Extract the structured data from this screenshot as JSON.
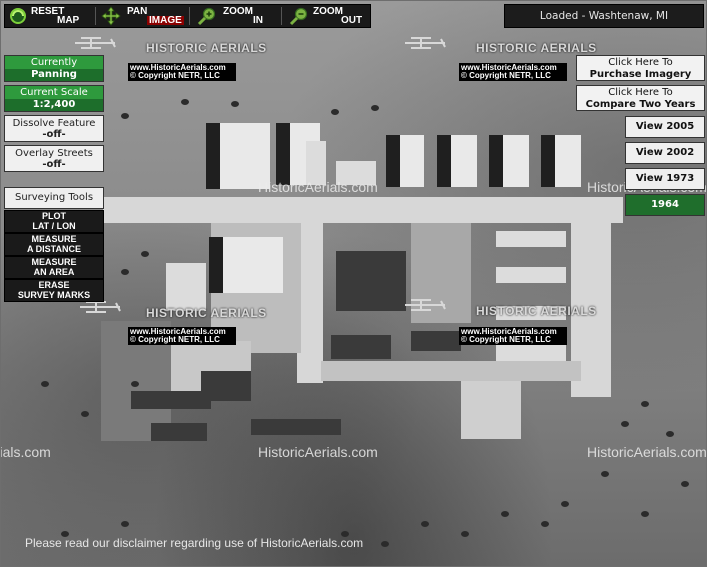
{
  "toolbar": {
    "reset": {
      "line1": "RESET",
      "line2": "MAP",
      "icon": "reset-globe-icon"
    },
    "pan": {
      "line1": "PAN",
      "line2": "IMAGE",
      "icon": "pan-arrows-icon"
    },
    "zoom_in": {
      "line1": "ZOOM",
      "line2": "IN",
      "icon": "magnifier-plus-icon"
    },
    "zoom_out": {
      "line1": "ZOOM",
      "line2": "OUT",
      "icon": "magnifier-minus-icon"
    }
  },
  "status": "Loaded - Washtenaw, MI",
  "left_panel": {
    "currently": {
      "label": "Currently",
      "value": "Panning"
    },
    "scale": {
      "label": "Current Scale",
      "value": "1:2,400"
    },
    "dissolve": {
      "label": "Dissolve Feature",
      "value": "-off-"
    },
    "overlay": {
      "label": "Overlay Streets",
      "value": "-off-"
    },
    "tools_title": "Surveying Tools",
    "tools": [
      {
        "line1": "PLOT",
        "line2": "LAT / LON"
      },
      {
        "line1": "MEASURE",
        "line2": "A DISTANCE"
      },
      {
        "line1": "MEASURE",
        "line2": "AN AREA"
      },
      {
        "line1": "ERASE",
        "line2": "SURVEY MARKS"
      }
    ]
  },
  "right_panel": {
    "purchase": {
      "line1": "Click Here To",
      "line2": "Purchase Imagery"
    },
    "compare": {
      "line1": "Click Here To",
      "line2": "Compare Two Years"
    },
    "years": [
      "View 2005",
      "View 2002",
      "View 1973",
      "1964"
    ],
    "active_year": "1964"
  },
  "watermark": {
    "logo": "HISTORIC AERIALS",
    "url": "www.HistoricAerials.com",
    "copyright": "© Copyright NETR, LLC",
    "text": "HistoricAerials.com"
  },
  "disclaimer": "Please read our disclaimer regarding use of HistoricAerials.com",
  "colors": {
    "accent_green": "#1f6e2c",
    "toolbar_bg": "#1a1a1a"
  }
}
